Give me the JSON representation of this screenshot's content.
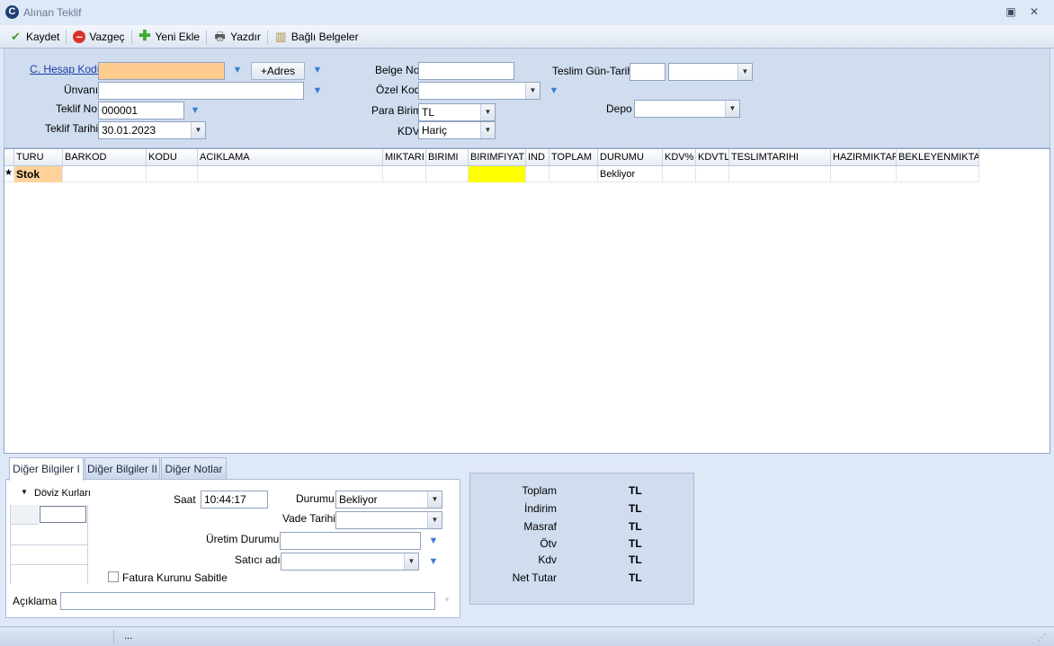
{
  "window": {
    "title": "Alınan Teklif",
    "logo": "C"
  },
  "toolbar": {
    "save": "Kaydet",
    "cancel": "Vazgeç",
    "add": "Yeni Ekle",
    "print": "Yazdır",
    "linked_docs": "Bağlı Belgeler"
  },
  "form": {
    "account_code_label": "C. Hesap Kodu",
    "account_code_value": "",
    "address_button": "+Adres",
    "title_label": "Ünvanı",
    "title_value": "",
    "offer_no_label": "Teklif No",
    "offer_no_value": "000001",
    "offer_date_label": "Teklif Tarihi",
    "offer_date_value": "30.01.2023",
    "doc_no_label": "Belge No",
    "doc_no_value": "",
    "special_code_label": "Özel Kod",
    "special_code_value": "",
    "currency_label": "Para Birimi",
    "currency_value": "TL",
    "vat_label": "KDV",
    "vat_value": "Hariç",
    "delivery_label": "Teslim Gün-Tarihi",
    "delivery_days": "",
    "delivery_date": "",
    "depot_label": "Depo",
    "depot_value": ""
  },
  "grid": {
    "columns": [
      "TURU",
      "BARKOD",
      "KODU",
      "ACIKLAMA",
      "MIKTARI",
      "BIRIMI",
      "BIRIMFIYAT",
      "IND",
      "TOPLAM",
      "DURUMU",
      "KDV%",
      "KDVTL",
      "TESLIMTARIHI",
      "HAZIRMIKTAR",
      "BEKLEYENMIKTAR"
    ],
    "row_marker": "★",
    "row": [
      "Stok",
      "",
      "",
      "",
      "",
      "",
      "",
      "",
      "",
      "Bekliyor",
      "",
      "",
      "",
      "",
      ""
    ]
  },
  "tabs": [
    "Diğer Bilgiler I",
    "Diğer Bilgiler II",
    "Diğer Notlar"
  ],
  "panel": {
    "currency_rates_label": "Döviz Kurları",
    "time_label": "Saat",
    "time_value": "10:44:17",
    "status_label": "Durumu",
    "status_value": "Bekliyor",
    "due_date_label": "Vade Tarihi",
    "due_date_value": "",
    "production_status_label": "Üretim Durumu",
    "production_status_value": "",
    "seller_label": "Satıcı adı",
    "seller_value": "",
    "fix_rate_label": "Fatura Kurunu Sabitle",
    "note_label": "Açıklama",
    "note_value": ""
  },
  "totals": [
    {
      "label": "Toplam",
      "value": "TL"
    },
    {
      "label": "İndirim",
      "value": "TL"
    },
    {
      "label": "Masraf",
      "value": "TL"
    },
    {
      "label": "Ötv",
      "value": "TL"
    },
    {
      "label": "Kdv",
      "value": "TL"
    },
    {
      "label": "Net Tutar",
      "value": "TL"
    }
  ],
  "status_bar": {
    "text": "..."
  },
  "colors": {
    "account_field": "#ffcc8f",
    "price_cell": "#ffff00",
    "type_cell": "#ffd29b"
  }
}
